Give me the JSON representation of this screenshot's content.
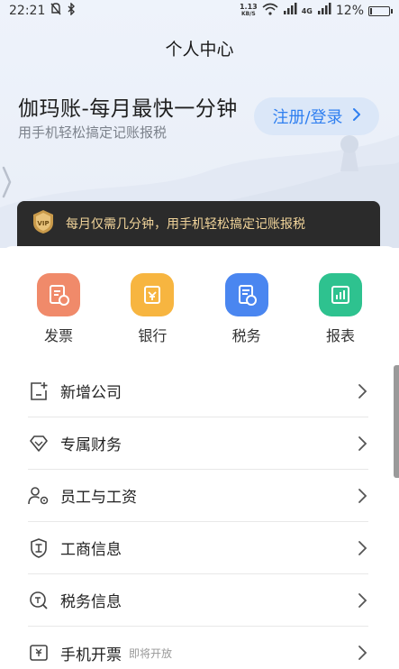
{
  "status_bar": {
    "time": "22:21",
    "net_speed_value": "1.13",
    "net_speed_unit": "KB/S",
    "network_type": "4G",
    "battery_text": "12%",
    "battery_level": 0.12
  },
  "header": {
    "title": "个人中心"
  },
  "promo": {
    "title": "伽玛账-每月最快一分钟",
    "subtitle": "用手机轻松搞定记账报税",
    "login_label": "注册/登录"
  },
  "vip_banner": {
    "badge": "VIP",
    "text": "每月仅需几分钟，用手机轻松搞定记账报税",
    "colors": {
      "background": "#2b2b2b",
      "text": "#f1d49a"
    }
  },
  "quick_actions": [
    {
      "label": "发票",
      "icon": "invoice-icon",
      "color": "#f08a6a"
    },
    {
      "label": "银行",
      "icon": "bank-icon",
      "color": "#f7b540"
    },
    {
      "label": "税务",
      "icon": "tax-icon",
      "color": "#4a86f0"
    },
    {
      "label": "报表",
      "icon": "report-icon",
      "color": "#2ec28f"
    }
  ],
  "menu": [
    {
      "label": "新增公司",
      "icon": "add-company-icon",
      "note": ""
    },
    {
      "label": "专属财务",
      "icon": "diamond-icon",
      "note": ""
    },
    {
      "label": "员工与工资",
      "icon": "employee-settings-icon",
      "note": ""
    },
    {
      "label": "工商信息",
      "icon": "business-shield-icon",
      "note": ""
    },
    {
      "label": "税务信息",
      "icon": "tax-search-icon",
      "note": ""
    },
    {
      "label": "手机开票",
      "icon": "mobile-invoice-icon",
      "note": "即将开放"
    }
  ]
}
